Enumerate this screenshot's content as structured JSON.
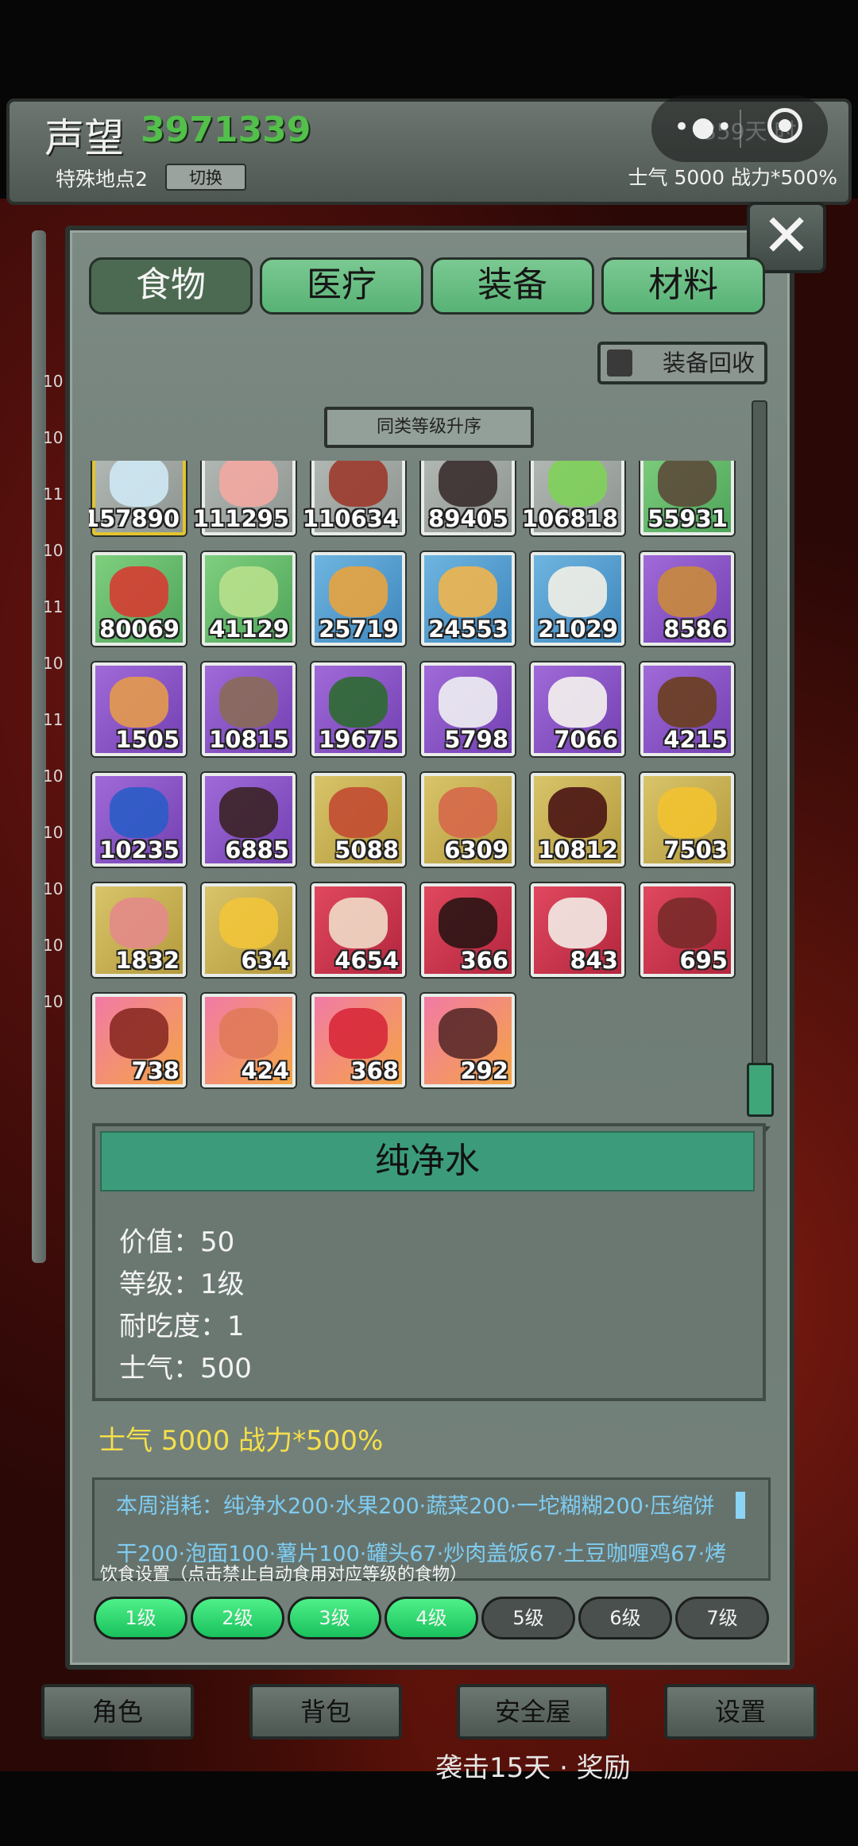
{
  "header": {
    "reputation_label": "声望",
    "reputation_value": "3971339",
    "location_label": "特殊地点2",
    "switch_label": "切换",
    "stats": "士气 5000  战力*500%",
    "capsule_dots": "•●•",
    "capsule_ghost": "359天 时"
  },
  "close_label": "✕",
  "tabs": [
    {
      "label": "食物",
      "active": true
    },
    {
      "label": "医疗",
      "active": false
    },
    {
      "label": "装备",
      "active": false
    },
    {
      "label": "材料",
      "active": false
    }
  ],
  "recycle_label": "装备回收",
  "sort_label": "同类等级升序",
  "side_numbers": [
    "10",
    "10",
    "11",
    "10",
    "11",
    "10",
    "11",
    "10",
    "10",
    "10",
    "10",
    "10"
  ],
  "items": [
    {
      "count": "157890",
      "quality": "white",
      "color": "#cfe9f5",
      "selected": true
    },
    {
      "count": "111295",
      "quality": "white",
      "color": "#f3a9a2"
    },
    {
      "count": "110634",
      "quality": "white",
      "color": "#9c3a2c"
    },
    {
      "count": "89405",
      "quality": "white",
      "color": "#3a2e2e"
    },
    {
      "count": "106818",
      "quality": "white",
      "color": "#7fd15a"
    },
    {
      "count": "55931",
      "quality": "green",
      "color": "#5c4a3a"
    },
    {
      "count": "80069",
      "quality": "green",
      "color": "#d63c32"
    },
    {
      "count": "41129",
      "quality": "green",
      "color": "#b8e08c"
    },
    {
      "count": "25719",
      "quality": "blue",
      "color": "#e8a33e"
    },
    {
      "count": "24553",
      "quality": "blue",
      "color": "#f0b54c"
    },
    {
      "count": "21029",
      "quality": "blue",
      "color": "#f2efe6"
    },
    {
      "count": "8586",
      "quality": "purple",
      "color": "#c98a3c"
    },
    {
      "count": "1505",
      "quality": "purple",
      "color": "#e49a4c"
    },
    {
      "count": "10815",
      "quality": "purple",
      "color": "#8a6a58"
    },
    {
      "count": "19675",
      "quality": "purple",
      "color": "#2d6a32"
    },
    {
      "count": "5798",
      "quality": "purple",
      "color": "#f0f0f2"
    },
    {
      "count": "7066",
      "quality": "purple",
      "color": "#f5f3ee"
    },
    {
      "count": "4215",
      "quality": "purple",
      "color": "#6a3e1e"
    },
    {
      "count": "10235",
      "quality": "purple",
      "color": "#2a5cc7"
    },
    {
      "count": "6885",
      "quality": "purple",
      "color": "#3b2226"
    },
    {
      "count": "5088",
      "quality": "gold",
      "color": "#c24b32"
    },
    {
      "count": "6309",
      "quality": "gold",
      "color": "#d6684a"
    },
    {
      "count": "10812",
      "quality": "gold",
      "color": "#4a1414"
    },
    {
      "count": "7503",
      "quality": "gold",
      "color": "#f2c230"
    },
    {
      "count": "1832",
      "quality": "gold",
      "color": "#e38a8a"
    },
    {
      "count": "634",
      "quality": "gold",
      "color": "#f2c43a"
    },
    {
      "count": "4654",
      "quality": "red",
      "color": "#f0dcc8"
    },
    {
      "count": "366",
      "quality": "red",
      "color": "#2a1414"
    },
    {
      "count": "843",
      "quality": "red",
      "color": "#f2ebe6"
    },
    {
      "count": "695",
      "quality": "red",
      "color": "#7a2a2a"
    },
    {
      "count": "738",
      "quality": "pink",
      "color": "#8a2a24"
    },
    {
      "count": "424",
      "quality": "pink",
      "color": "#e07a5a"
    },
    {
      "count": "368",
      "quality": "pink",
      "color": "#d8283a"
    },
    {
      "count": "292",
      "quality": "pink",
      "color": "#5a2a2a"
    }
  ],
  "detail": {
    "name": "纯净水",
    "lines": [
      "价值：50",
      "等级：1级",
      "耐吃度：1",
      "士气：500"
    ]
  },
  "morale_summary": "士气 5000  战力*500%",
  "consumption": {
    "line1": "本周消耗：纯净水200·水果200·蔬菜200·一坨糊糊200·压缩饼",
    "line2": "干200·泡面100·薯片100·罐头67·炒肉盖饭67·土豆咖喱鸡67·烤"
  },
  "diet_setting_label": "饮食设置（点击禁止自动食用对应等级的食物）",
  "levels": [
    {
      "label": "1级",
      "enabled": true
    },
    {
      "label": "2级",
      "enabled": true
    },
    {
      "label": "3级",
      "enabled": true
    },
    {
      "label": "4级",
      "enabled": true
    },
    {
      "label": "5级",
      "enabled": false
    },
    {
      "label": "6级",
      "enabled": false
    },
    {
      "label": "7级",
      "enabled": false
    }
  ],
  "bottom_nav": [
    "角色",
    "背包",
    "安全屋",
    "设置"
  ],
  "raid_text": "袭击15天 · 奖励",
  "colors": {
    "reputation": "#52c04a",
    "level_on": "#2fd86f",
    "detail_title_bg": "#3c9b7a",
    "morale_text": "#f5df4a",
    "consume_text": "#7fcdf2"
  }
}
